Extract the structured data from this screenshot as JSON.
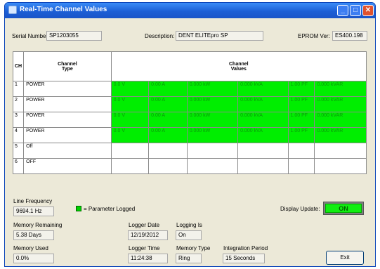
{
  "window": {
    "title": "Real-Time Channel Values"
  },
  "header": {
    "serial_label": "Serial Number:",
    "serial_value": "SP1203055",
    "desc_label": "Description:",
    "desc_value": "DENT ELITEpro SP",
    "eprom_label": "EPROM Ver:",
    "eprom_value": "ES400.198"
  },
  "grid": {
    "col_ch": "CH",
    "col_type_line1": "Channel",
    "col_type_line2": "Type",
    "col_values_line1": "Channel",
    "col_values_line2": "Values",
    "rows": [
      {
        "ch": "1",
        "type": "POWER",
        "logged": true,
        "values": [
          "0.0 V",
          "0.00 A",
          "0.000 kW",
          "0.000 kVA",
          "1.00 PF",
          "0.000 kVAR"
        ]
      },
      {
        "ch": "2",
        "type": "POWER",
        "logged": true,
        "values": [
          "0.0 V",
          "0.00 A",
          "0.000 kW",
          "0.000 kVA",
          "1.00 PF",
          "0.000 kVAR"
        ]
      },
      {
        "ch": "3",
        "type": "POWER",
        "logged": true,
        "values": [
          "0.0 V",
          "0.00 A",
          "0.000 kW",
          "0.000 kVA",
          "1.00 PF",
          "0.000 kVAR"
        ]
      },
      {
        "ch": "4",
        "type": "POWER",
        "logged": true,
        "values": [
          "0.0 V",
          "0.00 A",
          "0.000 kW",
          "0.000 kVA",
          "1.00 PF",
          "0.000 kVAR"
        ]
      },
      {
        "ch": "5",
        "type": "Off",
        "logged": false,
        "values": [
          "",
          "",
          "",
          "",
          "",
          ""
        ]
      },
      {
        "ch": "6",
        "type": "OFF",
        "logged": false,
        "values": [
          "",
          "",
          "",
          "",
          "",
          ""
        ]
      }
    ]
  },
  "status": {
    "line_freq_label": "Line Frequency",
    "line_freq_value": "9694.1 Hz",
    "legend_text": "= Parameter Logged",
    "display_update_label": "Display Update:",
    "display_update_value": "ON",
    "mem_remaining_label": "Memory Remaining",
    "mem_remaining_value": "5.38 Days",
    "mem_used_label": "Memory Used",
    "mem_used_value": "0.0%",
    "logger_date_label": "Logger Date",
    "logger_date_value": "12/19/2012",
    "logging_is_label": "Logging Is",
    "logging_is_value": "On",
    "logger_time_label": "Logger Time",
    "logger_time_value": "11:24:38",
    "memory_type_label": "Memory Type",
    "memory_type_value": "Ring",
    "integration_label": "Integration Period",
    "integration_value": "15 Seconds",
    "exit_label": "Exit"
  },
  "colors": {
    "logged": "#00ee00",
    "titlebar": "#1c5fd6",
    "window_bg": "#ece9d8"
  }
}
